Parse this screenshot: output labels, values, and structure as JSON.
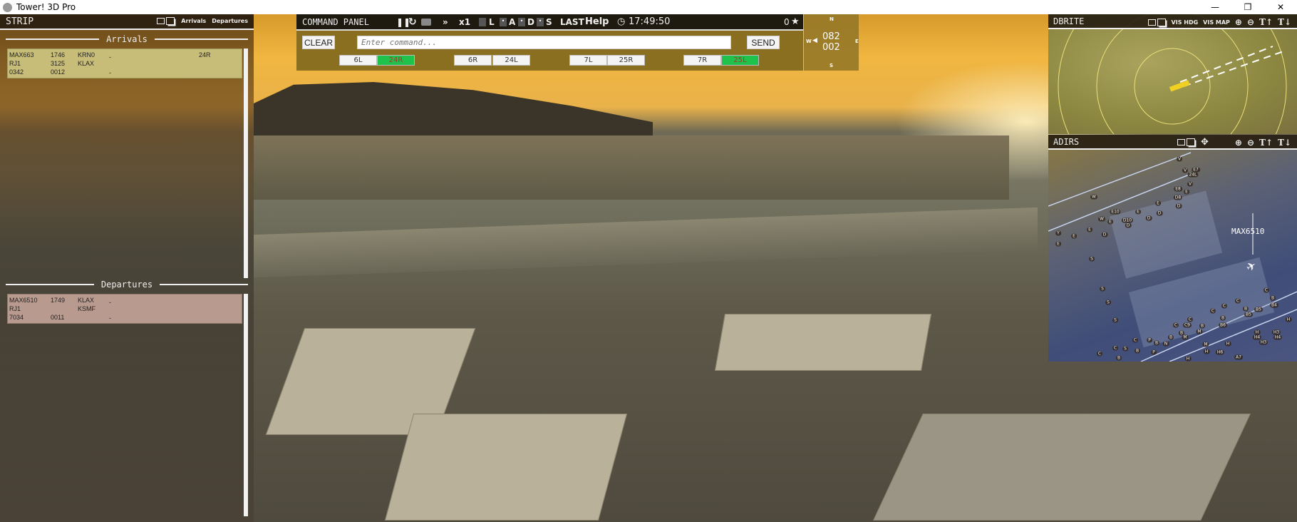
{
  "window": {
    "title": "Tower! 3D Pro",
    "controls": [
      "minimize",
      "restore",
      "close"
    ]
  },
  "strip": {
    "title": "STRIP",
    "tabs": [
      "Arrivals",
      "Departures"
    ],
    "arrivals_title": "Arrivals",
    "departures_title": "Departures",
    "arrivals": [
      {
        "callsign": "MAX663",
        "type": "RJ1",
        "squawk": "0342",
        "time": "1746",
        "alt": "3125",
        "code": "0012",
        "from": "KRN0",
        "to": "KLAX",
        "mark1": "-",
        "mark2": "-",
        "runway": "24R"
      }
    ],
    "departures": [
      {
        "callsign": "MAX6510",
        "type": "RJ1",
        "squawk": "7034",
        "time": "1749",
        "alt": "",
        "code": "0011",
        "from": "KLAX",
        "to": "KSMF",
        "mark1": "-",
        "mark2": "-",
        "runway": ""
      }
    ]
  },
  "command_panel": {
    "title": "COMMAND PANEL",
    "icons": [
      "pause-icon",
      "restart-icon",
      "camera-icon",
      "fast-forward-icon"
    ],
    "speed": "x1",
    "filters": [
      "L",
      "A",
      "D",
      "S"
    ],
    "last_label": "LAST",
    "help_label": "Help",
    "clock": "17:49:50",
    "score": "0",
    "clear_label": "CLEAR",
    "send_label": "SEND",
    "input_placeholder": "Enter command...",
    "input_value": "",
    "runways": [
      {
        "label": "6L",
        "active": false
      },
      {
        "label": "24R",
        "active": true
      },
      {
        "label": "6R",
        "active": false
      },
      {
        "label": "24L",
        "active": false
      },
      {
        "label": "7L",
        "active": false
      },
      {
        "label": "25R",
        "active": false
      },
      {
        "label": "7R",
        "active": false
      },
      {
        "label": "25L",
        "active": true
      }
    ],
    "active_color": "#1fc24a"
  },
  "compass": {
    "n": "N",
    "s": "S",
    "e": "E",
    "w": "W",
    "heading": "082",
    "speed": "002"
  },
  "dbrite": {
    "title": "DBRITE",
    "vis_hdg": "VIS HDG",
    "vis_map": "VIS MAP"
  },
  "adirs": {
    "title": "ADIRS",
    "callsign": "MAX6510",
    "taxiway_labels": [
      "V",
      "V",
      "E7",
      "24L",
      "V",
      "E8",
      "E",
      "W",
      "D8",
      "E",
      "D",
      "E10",
      "E",
      "D",
      "W",
      "E",
      "D10",
      "D",
      "D",
      "Y",
      "E",
      "E",
      "D",
      "E",
      "S",
      "S",
      "S",
      "S",
      "C",
      "B",
      "B4",
      "C",
      "C",
      "B",
      "B5",
      "B5",
      "C",
      "B",
      "C",
      "H",
      "B6",
      "C",
      "C9",
      "B",
      "M",
      "B",
      "M",
      "B",
      "H",
      "H3",
      "H4",
      "H4",
      "H3",
      "C",
      "P",
      "B",
      "N",
      "M",
      "H",
      "C",
      "S",
      "B",
      "P",
      "H",
      "H6",
      "C",
      "A7",
      "B",
      "H"
    ]
  }
}
